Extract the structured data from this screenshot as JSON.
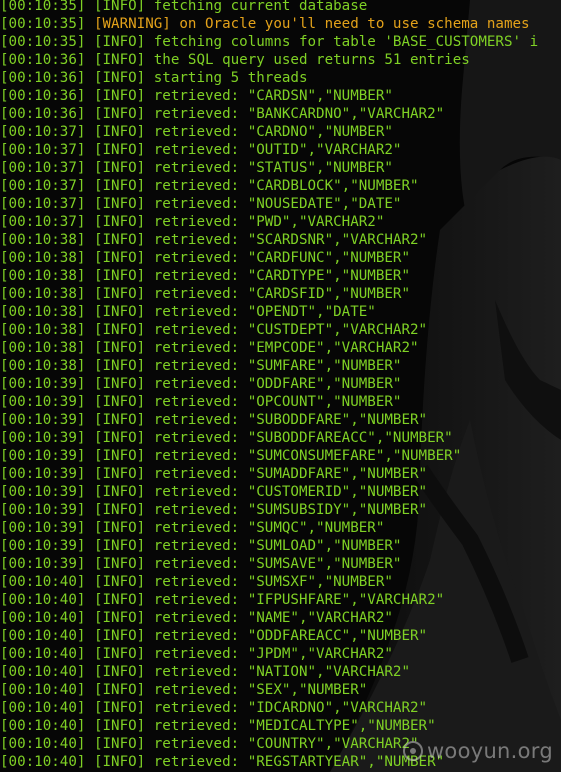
{
  "colors": {
    "info": "#7fd125",
    "warning": "#e3a21a",
    "background": "#060606"
  },
  "log": [
    {
      "time": "[00:10:35]",
      "level": "[INFO]",
      "message": "fetching current database"
    },
    {
      "time": "[00:10:35]",
      "level": "[WARNING]",
      "message": "on Oracle you'll need to use schema names"
    },
    {
      "time": "[00:10:35]",
      "level": "[INFO]",
      "message": "fetching columns for table 'BASE_CUSTOMERS' i"
    },
    {
      "time": "[00:10:36]",
      "level": "[INFO]",
      "message": "the SQL query used returns 51 entries"
    },
    {
      "time": "[00:10:36]",
      "level": "[INFO]",
      "message": "starting 5 threads"
    },
    {
      "time": "[00:10:36]",
      "level": "[INFO]",
      "message": "retrieved: \"CARDSN\",\"NUMBER\""
    },
    {
      "time": "[00:10:36]",
      "level": "[INFO]",
      "message": "retrieved: \"BANKCARDNO\",\"VARCHAR2\""
    },
    {
      "time": "[00:10:37]",
      "level": "[INFO]",
      "message": "retrieved: \"CARDNO\",\"NUMBER\""
    },
    {
      "time": "[00:10:37]",
      "level": "[INFO]",
      "message": "retrieved: \"OUTID\",\"VARCHAR2\""
    },
    {
      "time": "[00:10:37]",
      "level": "[INFO]",
      "message": "retrieved: \"STATUS\",\"NUMBER\""
    },
    {
      "time": "[00:10:37]",
      "level": "[INFO]",
      "message": "retrieved: \"CARDBLOCK\",\"NUMBER\""
    },
    {
      "time": "[00:10:37]",
      "level": "[INFO]",
      "message": "retrieved: \"NOUSEDATE\",\"DATE\""
    },
    {
      "time": "[00:10:37]",
      "level": "[INFO]",
      "message": "retrieved: \"PWD\",\"VARCHAR2\""
    },
    {
      "time": "[00:10:38]",
      "level": "[INFO]",
      "message": "retrieved: \"SCARDSNR\",\"VARCHAR2\""
    },
    {
      "time": "[00:10:38]",
      "level": "[INFO]",
      "message": "retrieved: \"CARDFUNC\",\"NUMBER\""
    },
    {
      "time": "[00:10:38]",
      "level": "[INFO]",
      "message": "retrieved: \"CARDTYPE\",\"NUMBER\""
    },
    {
      "time": "[00:10:38]",
      "level": "[INFO]",
      "message": "retrieved: \"CARDSFID\",\"NUMBER\""
    },
    {
      "time": "[00:10:38]",
      "level": "[INFO]",
      "message": "retrieved: \"OPENDT\",\"DATE\""
    },
    {
      "time": "[00:10:38]",
      "level": "[INFO]",
      "message": "retrieved: \"CUSTDEPT\",\"VARCHAR2\""
    },
    {
      "time": "[00:10:38]",
      "level": "[INFO]",
      "message": "retrieved: \"EMPCODE\",\"VARCHAR2\""
    },
    {
      "time": "[00:10:38]",
      "level": "[INFO]",
      "message": "retrieved: \"SUMFARE\",\"NUMBER\""
    },
    {
      "time": "[00:10:39]",
      "level": "[INFO]",
      "message": "retrieved: \"ODDFARE\",\"NUMBER\""
    },
    {
      "time": "[00:10:39]",
      "level": "[INFO]",
      "message": "retrieved: \"OPCOUNT\",\"NUMBER\""
    },
    {
      "time": "[00:10:39]",
      "level": "[INFO]",
      "message": "retrieved: \"SUBODDFARE\",\"NUMBER\""
    },
    {
      "time": "[00:10:39]",
      "level": "[INFO]",
      "message": "retrieved: \"SUBODDFAREACC\",\"NUMBER\""
    },
    {
      "time": "[00:10:39]",
      "level": "[INFO]",
      "message": "retrieved: \"SUMCONSUMEFARE\",\"NUMBER\""
    },
    {
      "time": "[00:10:39]",
      "level": "[INFO]",
      "message": "retrieved: \"SUMADDFARE\",\"NUMBER\""
    },
    {
      "time": "[00:10:39]",
      "level": "[INFO]",
      "message": "retrieved: \"CUSTOMERID\",\"NUMBER\""
    },
    {
      "time": "[00:10:39]",
      "level": "[INFO]",
      "message": "retrieved: \"SUMSUBSIDY\",\"NUMBER\""
    },
    {
      "time": "[00:10:39]",
      "level": "[INFO]",
      "message": "retrieved: \"SUMQC\",\"NUMBER\""
    },
    {
      "time": "[00:10:39]",
      "level": "[INFO]",
      "message": "retrieved: \"SUMLOAD\",\"NUMBER\""
    },
    {
      "time": "[00:10:39]",
      "level": "[INFO]",
      "message": "retrieved: \"SUMSAVE\",\"NUMBER\""
    },
    {
      "time": "[00:10:40]",
      "level": "[INFO]",
      "message": "retrieved: \"SUMSXF\",\"NUMBER\""
    },
    {
      "time": "[00:10:40]",
      "level": "[INFO]",
      "message": "retrieved: \"IFPUSHFARE\",\"VARCHAR2\""
    },
    {
      "time": "[00:10:40]",
      "level": "[INFO]",
      "message": "retrieved: \"NAME\",\"VARCHAR2\""
    },
    {
      "time": "[00:10:40]",
      "level": "[INFO]",
      "message": "retrieved: \"ODDFAREACC\",\"NUMBER\""
    },
    {
      "time": "[00:10:40]",
      "level": "[INFO]",
      "message": "retrieved: \"JPDM\",\"VARCHAR2\""
    },
    {
      "time": "[00:10:40]",
      "level": "[INFO]",
      "message": "retrieved: \"NATION\",\"VARCHAR2\""
    },
    {
      "time": "[00:10:40]",
      "level": "[INFO]",
      "message": "retrieved: \"SEX\",\"NUMBER\""
    },
    {
      "time": "[00:10:40]",
      "level": "[INFO]",
      "message": "retrieved: \"IDCARDNO\",\"VARCHAR2\""
    },
    {
      "time": "[00:10:40]",
      "level": "[INFO]",
      "message": "retrieved: \"MEDICALTYPE\",\"NUMBER\""
    },
    {
      "time": "[00:10:40]",
      "level": "[INFO]",
      "message": "retrieved: \"COUNTRY\",\"VARCHAR2\""
    },
    {
      "time": "[00:10:40]",
      "level": "[INFO]",
      "message": "retrieved: \"REGSTARTYEAR\",\"NUMBER\""
    }
  ],
  "watermark": {
    "text": "wooyun.org",
    "icon": "wooyun-logo-icon"
  }
}
